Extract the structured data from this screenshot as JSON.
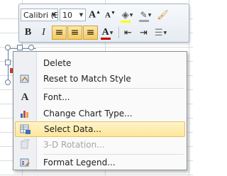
{
  "mini_toolbar": {
    "font_name": "Calibri (E",
    "font_size": "10",
    "grow_font_glyph": "A",
    "shrink_font_glyph": "A",
    "bold_glyph": "B",
    "italic_glyph": "I",
    "font_color_glyph": "A",
    "fill_color": "#ffff00",
    "font_color": "#c00000"
  },
  "context_menu": {
    "items": [
      {
        "label": "Delete",
        "icon": "none",
        "state": "normal"
      },
      {
        "label": "Reset to Match Style",
        "icon": "reset-style-icon",
        "state": "normal"
      },
      {
        "label": "Font...",
        "icon": "font-icon",
        "state": "normal"
      },
      {
        "label": "Change Chart Type...",
        "icon": "chart-type-icon",
        "state": "normal"
      },
      {
        "label": "Select Data...",
        "icon": "select-data-icon",
        "state": "highlighted"
      },
      {
        "label": "3-D Rotation...",
        "icon": "rotation-icon",
        "state": "disabled"
      },
      {
        "label": "Format Legend...",
        "icon": "format-legend-icon",
        "state": "normal"
      }
    ],
    "highlight_color": "#fde79b"
  }
}
